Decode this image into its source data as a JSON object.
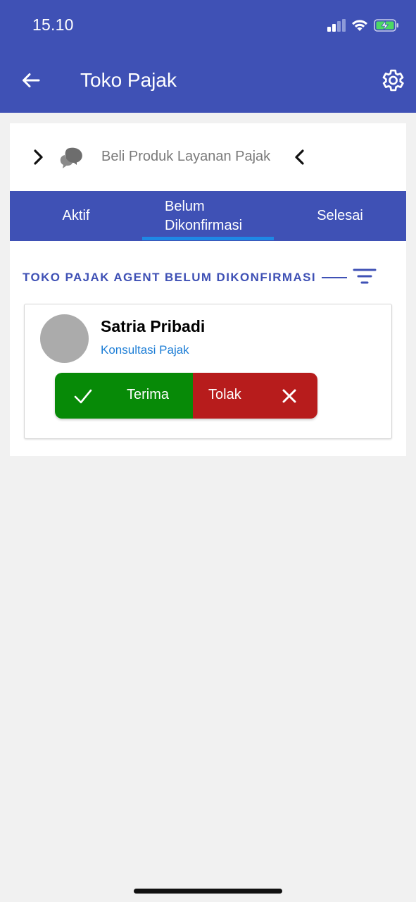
{
  "status_bar": {
    "time": "15.10",
    "icons": [
      "signal-icon",
      "wifi-icon",
      "battery-charging-icon"
    ]
  },
  "app_bar": {
    "title": "Toko Pajak",
    "back_icon": "arrow-left-icon",
    "settings_icon": "gear-icon"
  },
  "section_nav": {
    "label": "Beli Produk Layanan Pajak",
    "icons": [
      "chevron-right-icon",
      "chat-bubbles-icon",
      "chevron-left-icon"
    ]
  },
  "tabs": [
    {
      "label": "Aktif",
      "active": false
    },
    {
      "label_line1": "Belum",
      "label_line2": "Dikonfirmasi",
      "active": true
    },
    {
      "label": "Selesai",
      "active": false
    }
  ],
  "list": {
    "title": "TOKO PAJAK AGENT BELUM DIKONFIRMASI",
    "filter_icon": "filter-icon"
  },
  "agents": [
    {
      "name": "Satria Pribadi",
      "service": "Konsultasi Pajak",
      "accept_label": "Terima",
      "reject_label": "Tolak"
    }
  ],
  "colors": {
    "primary": "#3f51b5",
    "tab_indicator": "#1e88e5",
    "accept": "#078a07",
    "reject": "#b71c1c",
    "service_link": "#1e7ed6",
    "background": "#f1f1f1"
  }
}
